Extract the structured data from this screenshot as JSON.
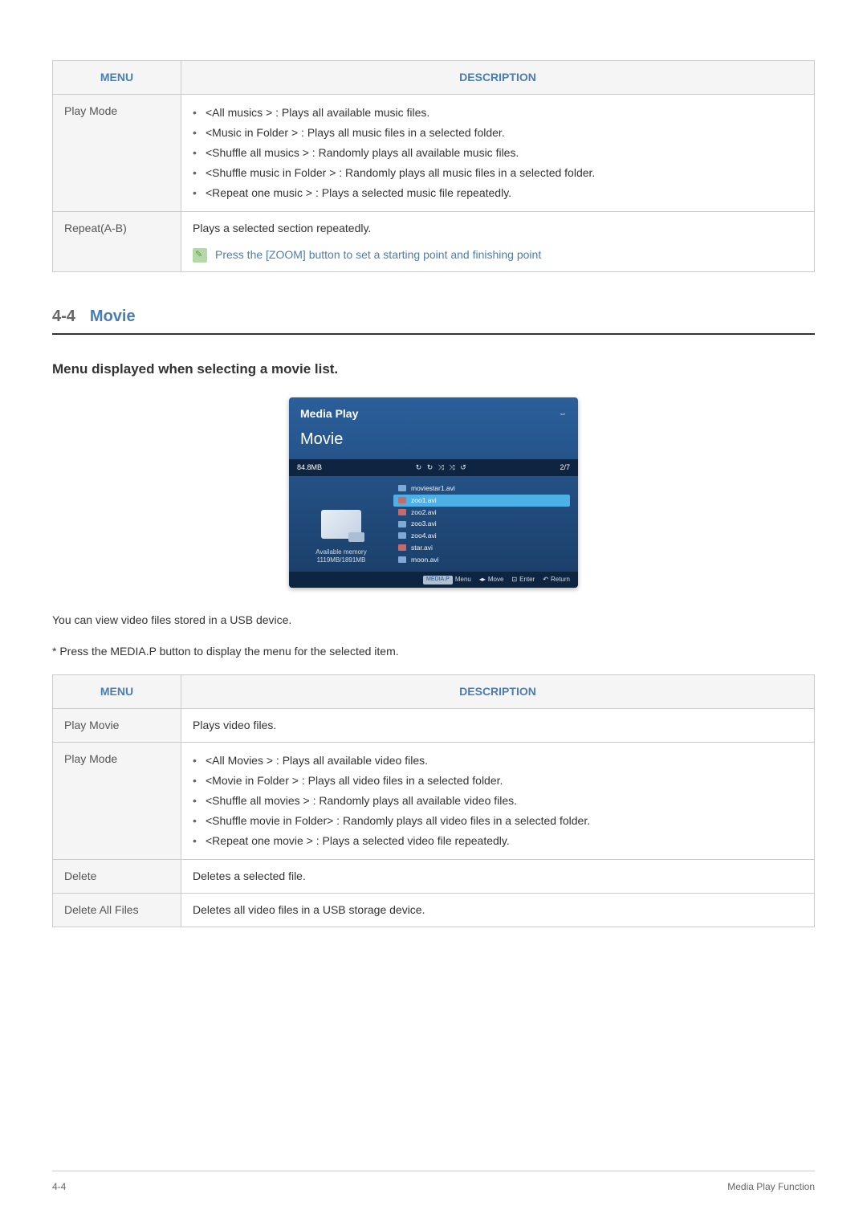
{
  "table1": {
    "headers": {
      "menu": "MENU",
      "description": "DESCRIPTION"
    },
    "rows": [
      {
        "menu": "Play Mode",
        "items": [
          "<All musics > : Plays all available music files.",
          "<Music in Folder > : Plays all music files in a selected folder.",
          "<Shuffle all musics > : Randomly plays all available music files.",
          "<Shuffle music in Folder > : Randomly plays all music files in a selected folder.",
          "<Repeat one music > : Plays a selected music file repeatedly."
        ]
      },
      {
        "menu": "Repeat(A-B)",
        "text": "Plays a selected section repeatedly.",
        "note": "Press the [ZOOM] button to set a starting point and finishing point"
      }
    ]
  },
  "section": {
    "number": "4-4",
    "title": "Movie"
  },
  "subsection": "Menu displayed when selecting a movie list.",
  "screenshot": {
    "title": "Media Play",
    "section": "Movie",
    "size": "84.8MB",
    "count": "2/7",
    "memory_label": "Available memory",
    "memory_value": "1119MB/1891MB",
    "files": [
      {
        "name": "moviestar1.avi",
        "sel": false,
        "cls": ""
      },
      {
        "name": "zoo1.avi",
        "sel": true,
        "cls": "red"
      },
      {
        "name": "zoo2.avi",
        "sel": false,
        "cls": "red"
      },
      {
        "name": "zoo3.avi",
        "sel": false,
        "cls": ""
      },
      {
        "name": "zoo4.avi",
        "sel": false,
        "cls": ""
      },
      {
        "name": "star.avi",
        "sel": false,
        "cls": "red"
      },
      {
        "name": "moon.avi",
        "sel": false,
        "cls": ""
      }
    ],
    "footer": {
      "badge": "MEDIA.P",
      "menu": "Menu",
      "move": "Move",
      "enter": "Enter",
      "return": "Return"
    }
  },
  "body_text_1": "You can view video files stored in a USB device.",
  "body_text_2": "* Press the MEDIA.P button to display the menu for the selected item.",
  "table2": {
    "headers": {
      "menu": "MENU",
      "description": "DESCRIPTION"
    },
    "rows": [
      {
        "menu": "Play Movie",
        "text": "Plays video files."
      },
      {
        "menu": "Play Mode",
        "items": [
          "<All Movies > : Plays all available video files.",
          "<Movie in Folder > : Plays all video files in a selected folder.",
          "<Shuffle all movies > : Randomly plays all available video files.",
          "<Shuffle movie in Folder> : Randomly plays all video files in a selected folder.",
          "<Repeat one movie > : Plays a selected video file repeatedly."
        ]
      },
      {
        "menu": "Delete",
        "text": "Deletes a selected file."
      },
      {
        "menu": "Delete All Files",
        "text": "Deletes all video files in a USB storage device."
      }
    ]
  },
  "footer": {
    "left": "4-4",
    "right": "Media Play Function"
  }
}
